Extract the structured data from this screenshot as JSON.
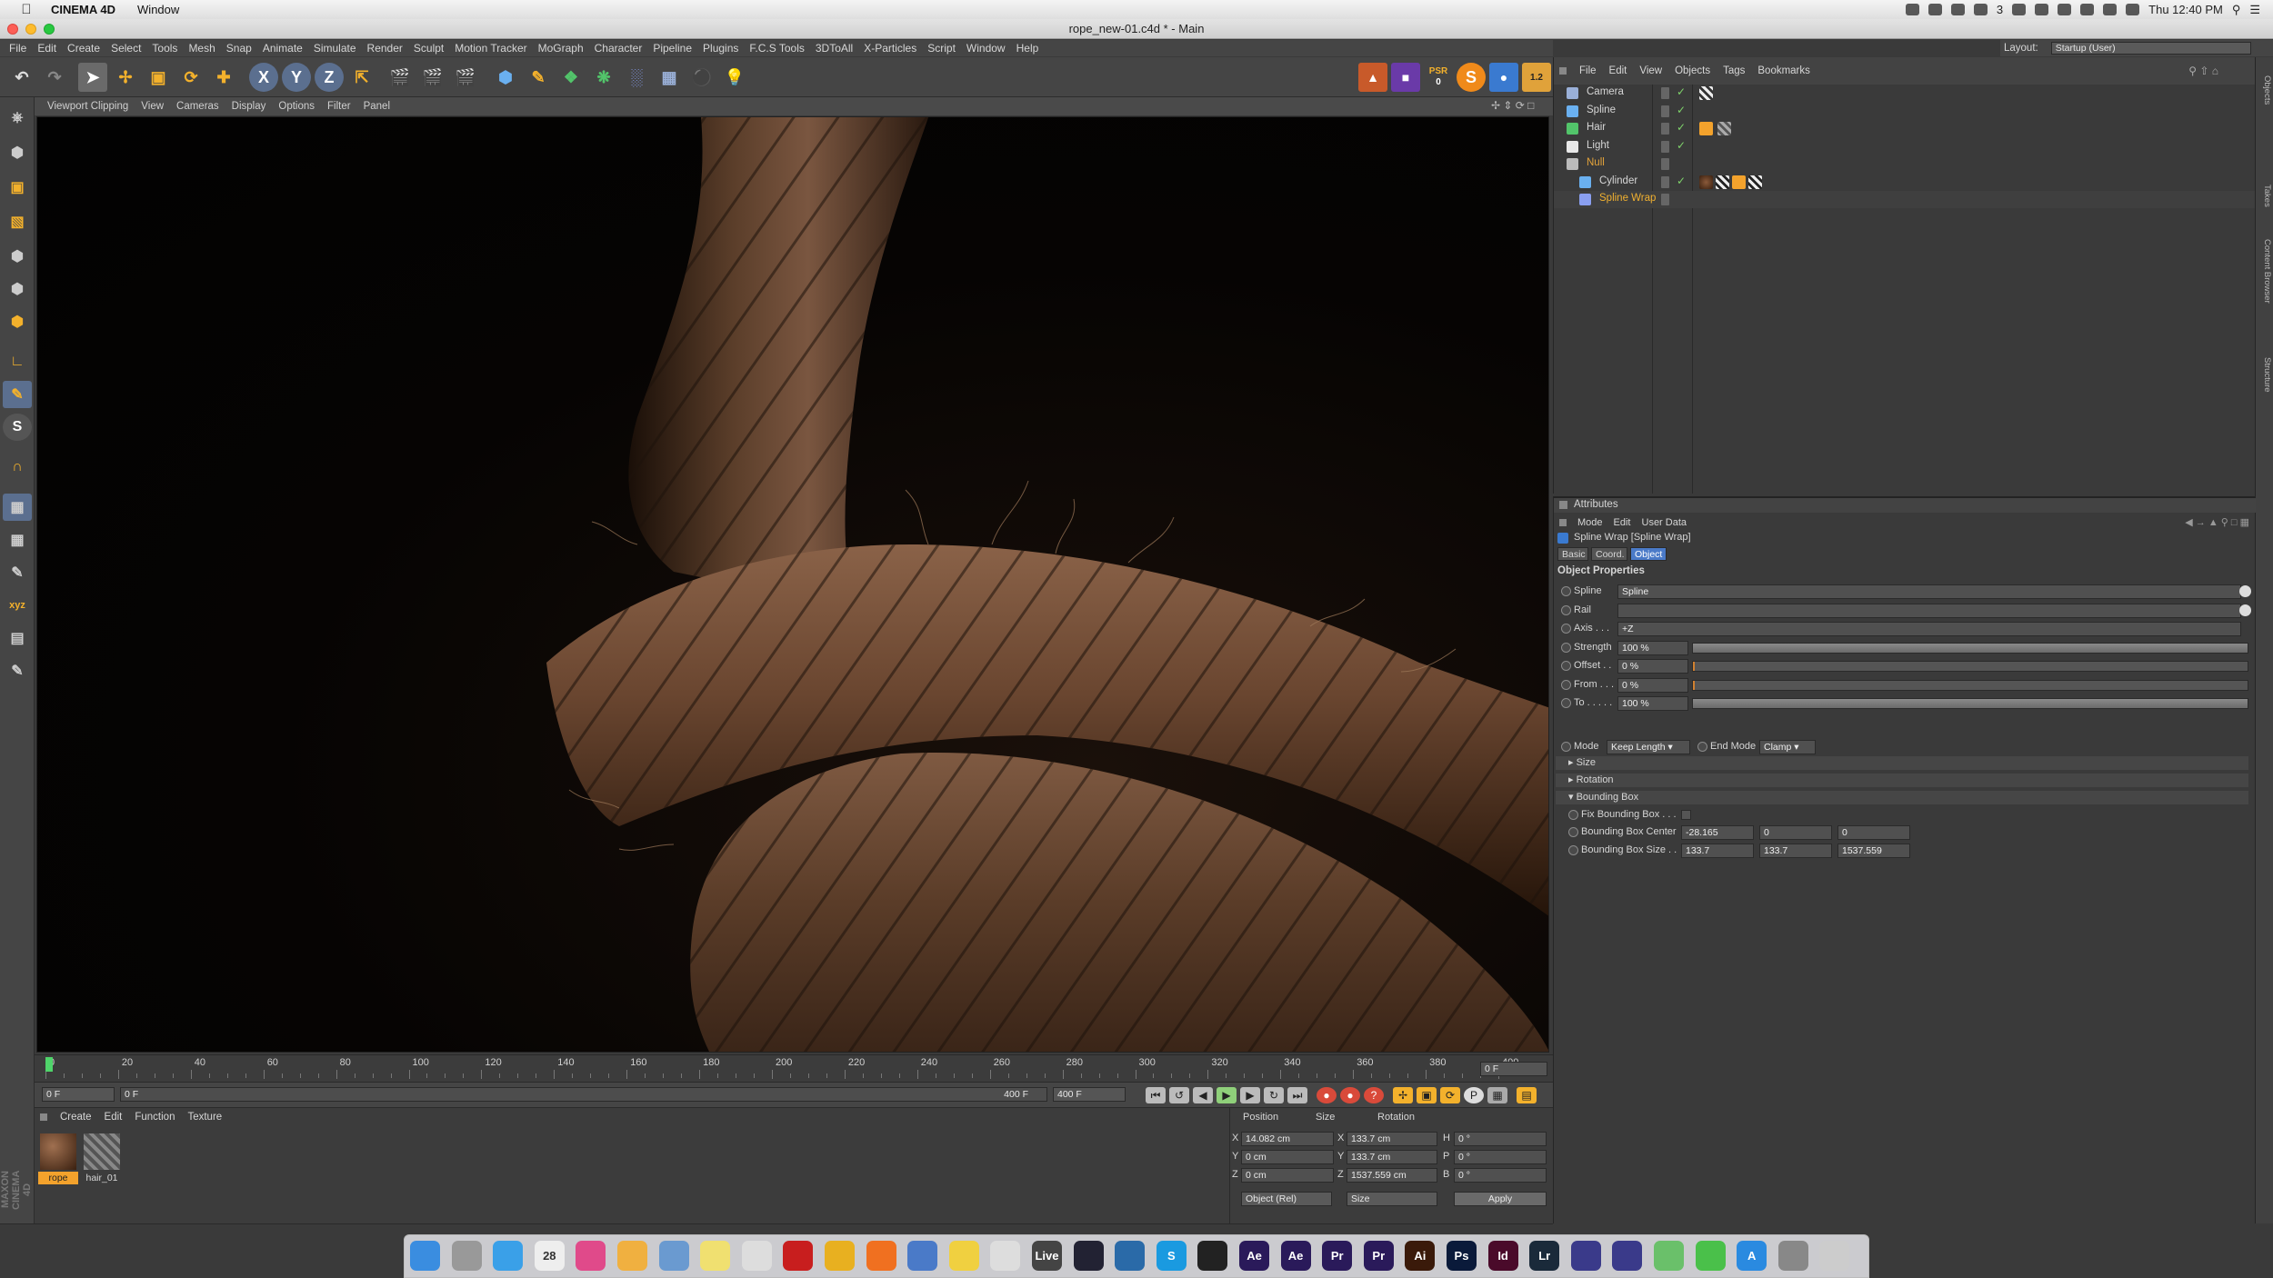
{
  "mac_menubar": {
    "app_name": "CINEMA 4D",
    "menu": "Window",
    "status_counter": "3",
    "clock": "Thu 12:40 PM"
  },
  "window": {
    "title": "rope_new-01.c4d * - Main"
  },
  "app_menu": [
    "File",
    "Edit",
    "Create",
    "Select",
    "Tools",
    "Mesh",
    "Snap",
    "Animate",
    "Simulate",
    "Render",
    "Sculpt",
    "Motion Tracker",
    "MoGraph",
    "Character",
    "Pipeline",
    "Plugins",
    "F.C.S Tools",
    "3DToAll",
    "X-Particles",
    "Script",
    "Window",
    "Help"
  ],
  "layout": {
    "label": "Layout:",
    "value": "Startup (User)"
  },
  "toolbar": {
    "axis_x": "X",
    "axis_y": "Y",
    "axis_z": "Z",
    "psr_label": "PSR",
    "psr_value": "0",
    "s_label": "S",
    "badge": "1.2"
  },
  "viewport_menu": [
    "Viewport Clipping",
    "View",
    "Cameras",
    "Display",
    "Options",
    "Filter",
    "Panel"
  ],
  "timeline": {
    "ticks": [
      "0",
      "20",
      "40",
      "60",
      "80",
      "100",
      "120",
      "140",
      "160",
      "180",
      "200",
      "220",
      "240",
      "260",
      "280",
      "300",
      "320",
      "340",
      "360",
      "380",
      "400"
    ],
    "current_frame": "0 F",
    "start_frame": "0 F",
    "range_start": "0 F",
    "range_end": "400 F",
    "end_frame": "400 F"
  },
  "material_manager": {
    "menu": [
      "Create",
      "Edit",
      "Function",
      "Texture"
    ],
    "materials": [
      {
        "name": "rope",
        "selected": true
      },
      {
        "name": "hair_01",
        "selected": false
      }
    ],
    "brand_line1": "MAXON",
    "brand_line2": "CINEMA 4D"
  },
  "coordinates": {
    "headers": [
      "Position",
      "Size",
      "Rotation"
    ],
    "rows": [
      {
        "axis": "X",
        "position": "14.082 cm",
        "size_axis": "X",
        "size": "133.7 cm",
        "rot_axis": "H",
        "rotation": "0 °"
      },
      {
        "axis": "Y",
        "position": "0 cm",
        "size_axis": "Y",
        "size": "133.7 cm",
        "rot_axis": "P",
        "rotation": "0 °"
      },
      {
        "axis": "Z",
        "position": "0 cm",
        "size_axis": "Z",
        "size": "1537.559 cm",
        "rot_axis": "B",
        "rotation": "0 °"
      }
    ],
    "mode_select": "Object (Rel)",
    "size_select": "Size",
    "apply": "Apply"
  },
  "object_manager": {
    "menu": [
      "File",
      "Edit",
      "View",
      "Objects",
      "Tags",
      "Bookmarks"
    ],
    "objects": [
      {
        "name": "Camera",
        "icon": "camera-icon",
        "indent": 0,
        "color": "#d6d6d6"
      },
      {
        "name": "Spline",
        "icon": "spline-icon",
        "indent": 0,
        "color": "#d6d6d6"
      },
      {
        "name": "Hair",
        "icon": "hair-icon",
        "indent": 0,
        "color": "#d6d6d6"
      },
      {
        "name": "Light",
        "icon": "light-icon",
        "indent": 0,
        "color": "#d6d6d6"
      },
      {
        "name": "Null",
        "icon": "null-icon",
        "indent": 0,
        "color": "#e2a23a"
      },
      {
        "name": "Cylinder",
        "icon": "cylinder-icon",
        "indent": 1,
        "color": "#d6d6d6"
      },
      {
        "name": "Spline Wrap",
        "icon": "spline-wrap-icon",
        "indent": 1,
        "color": "#f0b030"
      }
    ]
  },
  "right_tabs": [
    "Objects",
    "Takes",
    "Content Browser",
    "Structure"
  ],
  "attributes": {
    "title": "Attributes",
    "menu": [
      "Mode",
      "Edit",
      "User Data"
    ],
    "object_title": "Spline Wrap [Spline Wrap]",
    "tabs": [
      "Basic",
      "Coord.",
      "Object"
    ],
    "active_tab": "Object",
    "section": "Object Properties",
    "fields": [
      {
        "label": "Spline",
        "value": "Spline"
      },
      {
        "label": "Rail",
        "value": ""
      },
      {
        "label": "Axis . . .",
        "value": "+Z"
      },
      {
        "label": "Strength",
        "value": "100 %",
        "fraction": 1.0
      },
      {
        "label": "Offset . .",
        "value": "0 %",
        "fraction": 0.0
      },
      {
        "label": "From . . .",
        "value": "0 %",
        "fraction": 0.0
      },
      {
        "label": "To . . . . .",
        "value": "100 %",
        "fraction": 1.0
      }
    ],
    "mode_label": "Mode",
    "mode_value": "Keep Length",
    "end_mode_label": "End Mode",
    "end_mode_value": "Clamp",
    "groups": [
      "Size",
      "Rotation",
      "Bounding Box"
    ],
    "fix_bbox_label": "Fix Bounding Box . . .",
    "bbox_center_label": "Bounding Box Center",
    "bbox_center": [
      "-28.165",
      "0",
      "0"
    ],
    "bbox_size_label": "Bounding Box Size . .",
    "bbox_size": [
      "133.7",
      "133.7",
      "1537.559"
    ]
  },
  "dock": {
    "calendar_day": "28",
    "apps": [
      "Finder",
      "Launchpad",
      "Safari",
      "Calendar",
      "iTunes",
      "Photos",
      "Preview",
      "Notes",
      "TextEdit",
      "Acrobat",
      "Chrome",
      "Firefox",
      "Cinema",
      "Stickies",
      "Reminders",
      "Live",
      "Steam",
      "Cyberduck",
      "Skype",
      "C4D",
      "After Effects",
      "Adobe Ae",
      "Premiere",
      "Premiere Pro",
      "Illustrator",
      "Photoshop",
      "InDesign",
      "Lightroom",
      "FCP",
      "Motion",
      "Maps",
      "Messages",
      "App Store",
      "System Preferences",
      "Trash"
    ]
  }
}
